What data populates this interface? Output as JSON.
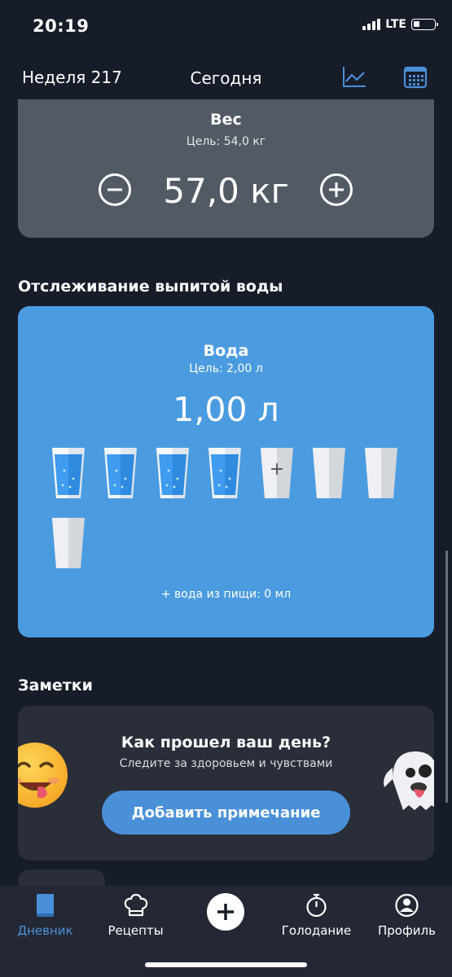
{
  "status": {
    "time": "20:19",
    "network": "LTE"
  },
  "header": {
    "week": "Неделя 217",
    "title": "Сегодня",
    "chart_icon": "chart-line-icon",
    "calendar_icon": "calendar-icon"
  },
  "weight": {
    "title": "Вес",
    "goal": "Цель: 54,0 кг",
    "value": "57,0 кг"
  },
  "water": {
    "section_title": "Отслеживание выпитой воды",
    "title": "Вода",
    "goal": "Цель: 2,00 л",
    "value": "1,00 л",
    "glasses": [
      "full",
      "full",
      "full",
      "full",
      "add",
      "empty",
      "empty",
      "empty"
    ],
    "glasses_filled": 4,
    "glasses_total": 8,
    "add_symbol": "+",
    "food_water": "+ вода из пищи: 0 мл"
  },
  "notes": {
    "section_title": "Заметки",
    "question": "Как прошел ваш день?",
    "subtitle": "Следите за здоровьем и чувствами",
    "add_button": "Добавить примечание"
  },
  "tabs": [
    {
      "label": "Дневник",
      "icon": "book-icon",
      "active": true
    },
    {
      "label": "Рецепты",
      "icon": "chef-hat-icon",
      "active": false
    },
    {
      "label": "",
      "icon": "plus-icon",
      "active": false
    },
    {
      "label": "Голодание",
      "icon": "stopwatch-icon",
      "active": false
    },
    {
      "label": "Профиль",
      "icon": "user-icon",
      "active": false
    }
  ],
  "colors": {
    "background": "#171c29",
    "accent": "#4a90d9",
    "water_card": "#4b9be0",
    "weight_card": "#525a64"
  }
}
